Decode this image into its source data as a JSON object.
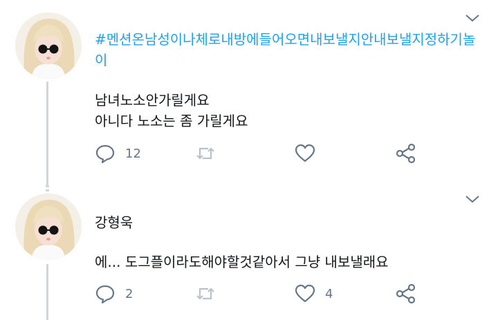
{
  "tweets": [
    {
      "hashtag": "#멘션온남성이나체로내방에들어오면내보낼지안내보낼지정하기놀이",
      "text_lines": [
        "남녀노소안가릴게요",
        "아니다 노소는 좀 가릴게요"
      ],
      "reply_count": "12",
      "retweet_count": "",
      "like_count": ""
    },
    {
      "name": "강형욱",
      "text_lines": [
        "에... 도그플이라도해야할것같아서 그냥 내보낼래요"
      ],
      "reply_count": "2",
      "retweet_count": "",
      "like_count": "4"
    }
  ],
  "icons": {
    "reply": "reply-icon",
    "retweet": "retweet-icon",
    "like": "heart-icon",
    "share": "share-icon",
    "menu": "chevron-down-icon"
  },
  "colors": {
    "hashtag": "#1da1f2",
    "icon": "#657786",
    "thread_line": "#ccd6dd"
  }
}
